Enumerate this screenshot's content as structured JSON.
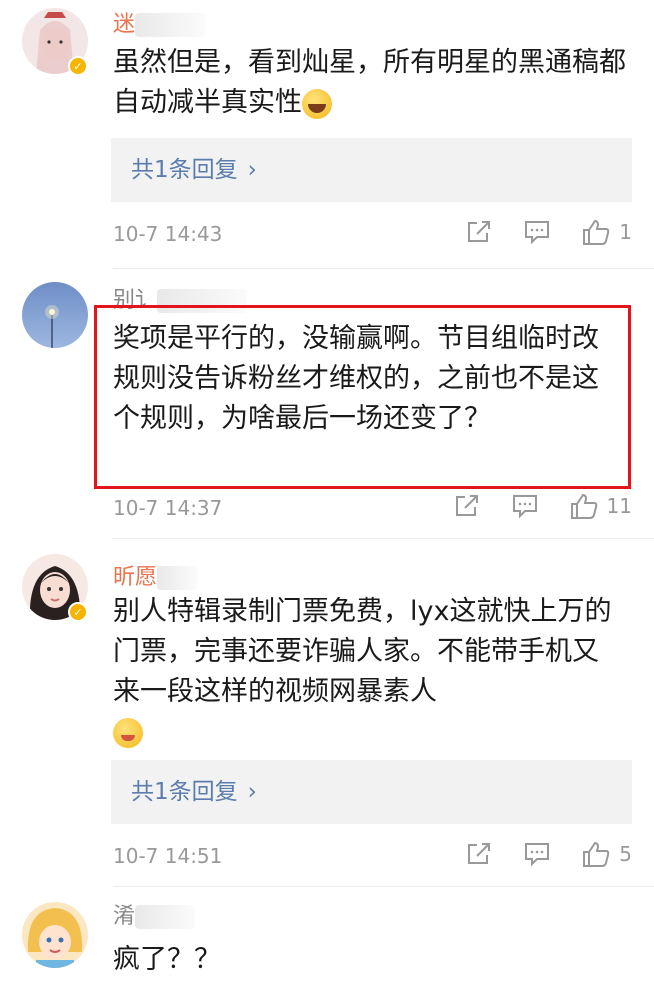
{
  "comments": [
    {
      "username": "迷",
      "text": "虽然但是，看到灿星，所有明星的黑通稿都自动减半真实性",
      "emoji": "laughing-tears-emoji",
      "reply_label": "共1条回复",
      "time": "10-7 14:43",
      "likes": "1"
    },
    {
      "username": "别讠",
      "text": "奖项是平行的，没输赢啊。节目组临时改规则没告诉粉丝才维权的，之前也不是这个规则，为啥最后一场还变了？",
      "time": "10-7 14:37",
      "likes": "11"
    },
    {
      "username": "昕愿",
      "text": "别人特辑录制门票免费，lyx这就快上万的门票，完事还要诈骗人家。不能带手机又来一段这样的视频网暴素人",
      "emoji": "drooling-emoji",
      "reply_label": "共1条回复",
      "time": "10-7 14:51",
      "likes": "5"
    },
    {
      "username": "淆",
      "text": "疯了？？"
    }
  ],
  "icons": {
    "share": "share-icon",
    "comment": "comment-icon",
    "like": "thumbs-up-icon",
    "verified": "verified-badge-icon"
  },
  "colors": {
    "username": "#eb7350",
    "reply_link": "#5a7dad",
    "highlight": "#e3141e"
  }
}
